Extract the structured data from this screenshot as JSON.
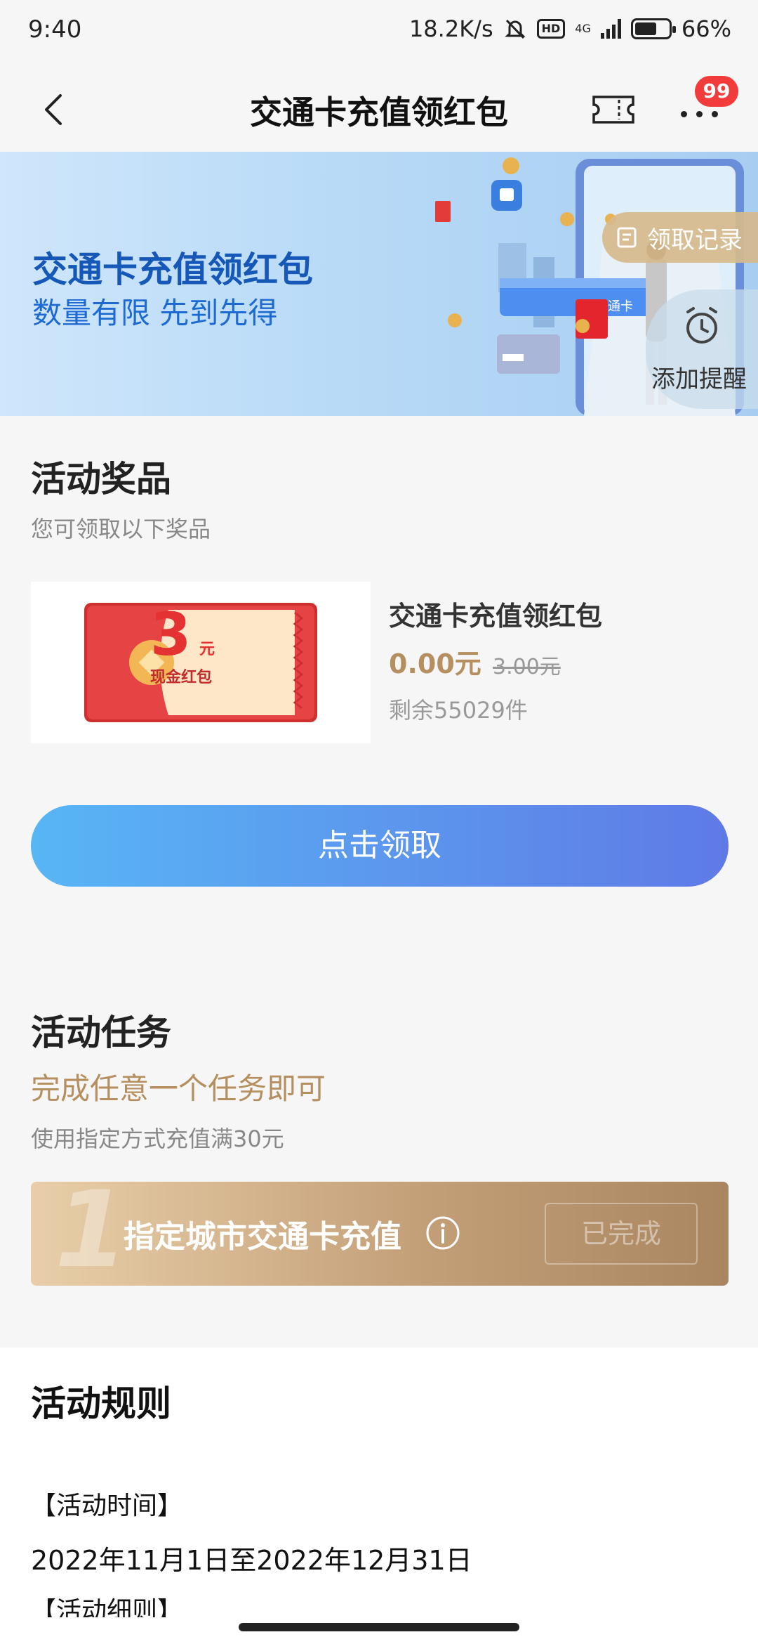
{
  "status_bar": {
    "time": "9:40",
    "net_speed": "18.2K/s",
    "hd_label": "HD",
    "network": "4G",
    "battery": "66%",
    "icons": [
      "mute-bell-icon",
      "hd-icon",
      "signal-icon",
      "battery-icon"
    ]
  },
  "nav": {
    "title": "交通卡充值领红包",
    "badge": "99",
    "icons": [
      "back-chevron-icon",
      "ticket-icon",
      "more-icon"
    ]
  },
  "banner": {
    "title": "交通卡充值领红包",
    "subtitle": "数量有限 先到先得",
    "card_text": "交通卡",
    "record_label": "领取记录",
    "remind_label": "添加提醒"
  },
  "prize": {
    "title": "活动奖品",
    "subtitle": "您可领取以下奖品",
    "coupon_amount": "3",
    "coupon_unit": "元",
    "coupon_label": "现金红包",
    "name": "交通卡充值领红包",
    "price": "0.00元",
    "original_price": "3.00元",
    "stock": "剩余55029件",
    "claim_button": "点击领取"
  },
  "task": {
    "title": "活动任务",
    "subtitle": "完成任意一个任务即可",
    "desc": "使用指定方式充值满30元",
    "items": [
      {
        "number": "1",
        "text": "指定城市交通卡充值",
        "status": "已完成"
      }
    ]
  },
  "rules": {
    "title": "活动规则",
    "time_header": "【活动时间】",
    "time_value": "2022年11月1日至2022年12月31日",
    "detail_header": "【活动细则】"
  },
  "colors": {
    "accent_blue": "#1558b8",
    "gold": "#b58f5f",
    "badge_red": "#f23c3c",
    "button_start": "#58b6f5",
    "button_end": "#5f7ae6"
  }
}
